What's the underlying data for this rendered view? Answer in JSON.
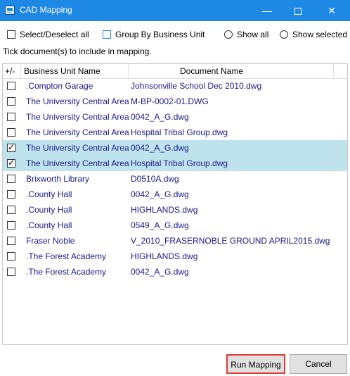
{
  "window": {
    "title": "CAD Mapping"
  },
  "toolbar": {
    "select_all_label": "Select/Deselect all",
    "group_by_label": "Group By Business Unit",
    "show_all_label": "Show all",
    "show_selected_label": "Show selected"
  },
  "hint": "Tick document(s) to include in mapping.",
  "grid": {
    "headers": {
      "toggle": "+/-",
      "business_unit": "Business Unit Name",
      "document": "Document Name"
    },
    "rows": [
      {
        "checked": false,
        "business_unit": ".Compton Garage",
        "document": "Johnsonville School Dec 2010.dwg"
      },
      {
        "checked": false,
        "business_unit": "The University Central Area",
        "document": "M-BP-0002-01.DWG"
      },
      {
        "checked": false,
        "business_unit": "The University Central Area",
        "document": "0042_A_G.dwg"
      },
      {
        "checked": false,
        "business_unit": "The University Central Area",
        "document": "Hospital Tribal Group.dwg"
      },
      {
        "checked": true,
        "business_unit": "The University Central Area",
        "document": "0042_A_G.dwg"
      },
      {
        "checked": true,
        "business_unit": "The University Central Area",
        "document": "Hospital Tribal Group.dwg"
      },
      {
        "checked": false,
        "business_unit": "Brixworth Library",
        "document": "D0510A.dwg"
      },
      {
        "checked": false,
        "business_unit": ".County Hall",
        "document": "0042_A_G.dwg"
      },
      {
        "checked": false,
        "business_unit": ".County Hall",
        "document": "HIGHLANDS.dwg"
      },
      {
        "checked": false,
        "business_unit": ".County Hall",
        "document": "0549_A_G.dwg"
      },
      {
        "checked": false,
        "business_unit": "Fraser Noble",
        "document": "V_2010_FRASERNOBLE GROUND APRIL2015.dwg"
      },
      {
        "checked": false,
        "business_unit": ".The Forest Academy",
        "document": "HIGHLANDS.dwg"
      },
      {
        "checked": false,
        "business_unit": ".The Forest Academy",
        "document": "0042_A_G.dwg"
      }
    ]
  },
  "buttons": {
    "run": "Run Mapping",
    "cancel": "Cancel"
  }
}
